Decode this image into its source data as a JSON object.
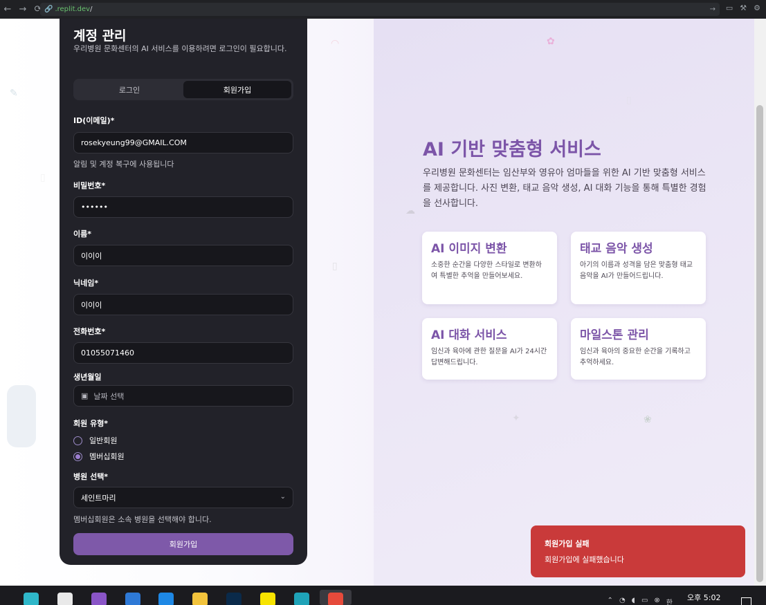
{
  "browser": {
    "url_host": ".replit.dev",
    "url_path": "/",
    "nav_back": "←",
    "nav_forward": "→",
    "nav_reload": "⟳",
    "lock_icon": "link-icon",
    "tools": [
      "monitor-icon",
      "wrench-icon",
      "gear-icon"
    ]
  },
  "auth_card": {
    "title": "계정 관리",
    "description": "우리병원 문화센터의 AI 서비스를 이용하려면 로그인이 필요합니다.",
    "tabs": [
      {
        "label": "로그인",
        "active": false
      },
      {
        "label": "회원가입",
        "active": true
      }
    ],
    "fields": {
      "id": {
        "label": "ID(이메일)*",
        "value": "rosekyeung99@GMAIL.COM",
        "hint": "알림 및 계정 복구에 사용됩니다"
      },
      "password": {
        "label": "비밀번호*",
        "value": "••••••"
      },
      "name": {
        "label": "이름*",
        "value": "이이이"
      },
      "nickname": {
        "label": "닉네임*",
        "value": "이이이"
      },
      "phone": {
        "label": "전화번호*",
        "value": "01055071460"
      },
      "birth": {
        "label": "생년월일",
        "placeholder": "날짜 선택"
      },
      "member_type": {
        "label": "회원 유형*",
        "options": [
          {
            "label": "일반회원",
            "checked": false
          },
          {
            "label": "멤버십회원",
            "checked": true
          }
        ]
      },
      "hospital": {
        "label": "병원 선택*",
        "value": "세인트마리",
        "hint": "멤버십회원은 소속 병원을 선택해야 합니다."
      }
    },
    "submit_label": "회원가입"
  },
  "hero": {
    "title": "AI 기반 맞춤형 서비스",
    "description": "우리병원 문화센터는 임산부와 영유아 엄마들을 위한 AI 기반 맞춤형 서비스를 제공합니다. 사진 변환, 태교 음악 생성, AI 대화 기능을 통해 특별한 경험을 선사합니다.",
    "features": [
      {
        "title": "AI 이미지 변환",
        "desc": "소중한 순간을 다양한 스타일로 변환하여 특별한 추억을 만들어보세요."
      },
      {
        "title": "태교 음악 생성",
        "desc": "아기의 이름과 성격을 담은 맞춤형 태교 음악을 AI가 만들어드립니다."
      },
      {
        "title": "AI 대화 서비스",
        "desc": "임신과 육아에 관한 질문을 AI가 24시간 답변해드립니다."
      },
      {
        "title": "마일스톤 관리",
        "desc": "임신과 육아의 중요한 순간을 기록하고 추억하세요."
      }
    ]
  },
  "toast": {
    "title": "회원가입 실패",
    "message": "회원가입에 실패했습니다"
  },
  "taskbar": {
    "clock": "오후 5:02",
    "ime": "한",
    "apps": [
      "copilot-icon",
      "capcut-icon",
      "github-desktop-icon",
      "vscode-icon",
      "bluesky-icon",
      "file-explorer-icon",
      "photoshop-icon",
      "kakaotalk-icon",
      "edge-icon",
      "chrome-icon"
    ],
    "colors": {
      "accent": "#7e59a9",
      "error": "#c93a3a"
    }
  }
}
